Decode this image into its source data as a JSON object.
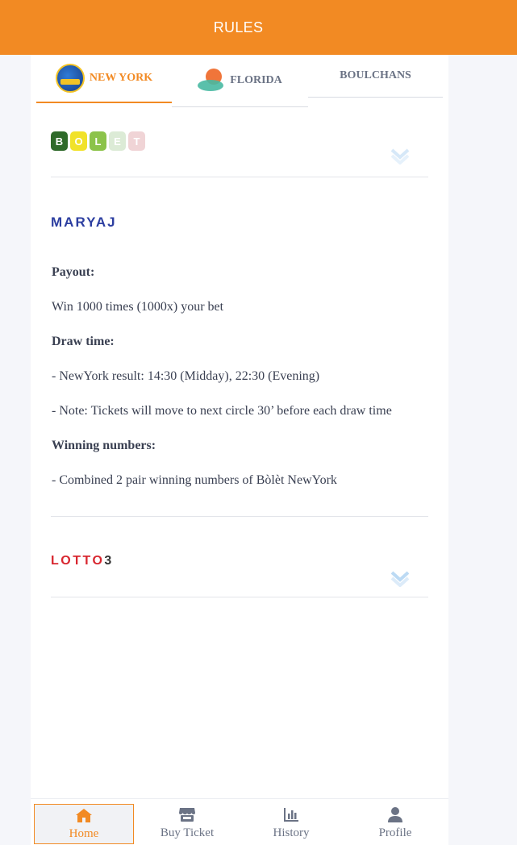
{
  "header": {
    "title": "RULES"
  },
  "tabs": [
    {
      "label": "NEW YORK",
      "logo": "new-york-lottery-logo",
      "active": true
    },
    {
      "label": "FLORIDA",
      "logo": "florida-lottery-logo",
      "active": false
    },
    {
      "label": "BOULCHANS",
      "logo": "",
      "active": false
    }
  ],
  "sections": {
    "bolet": {
      "letters": [
        "B",
        "O",
        "L",
        "E",
        "T"
      ],
      "expanded": false
    },
    "maryaj": {
      "title": "MARYAJ",
      "expanded": true,
      "rules": {
        "payout_label": "Payout:",
        "payout_text": "Win 1000 times (1000x) your bet",
        "draw_label": "Draw time:",
        "draw_result": "- NewYork result: 14:30 (Midday), 22:30 (Evening)",
        "draw_note": "- Note: Tickets will move to next circle 30’ before each draw time",
        "winning_label": "Winning numbers:",
        "winning_text": "- Combined 2 pair winning numbers of Bòlèt NewYork"
      }
    },
    "lotto3": {
      "title_letters": "LOTTO",
      "title_number": "3",
      "expanded": false
    }
  },
  "nav": {
    "home": "Home",
    "buy": "Buy Ticket",
    "history": "History",
    "profile": "Profile"
  },
  "colors": {
    "accent": "#f28a23",
    "text": "#3a4052",
    "muted": "#6b7385",
    "maryaj": "#2c3ea0",
    "lotto": "#d8262f"
  }
}
